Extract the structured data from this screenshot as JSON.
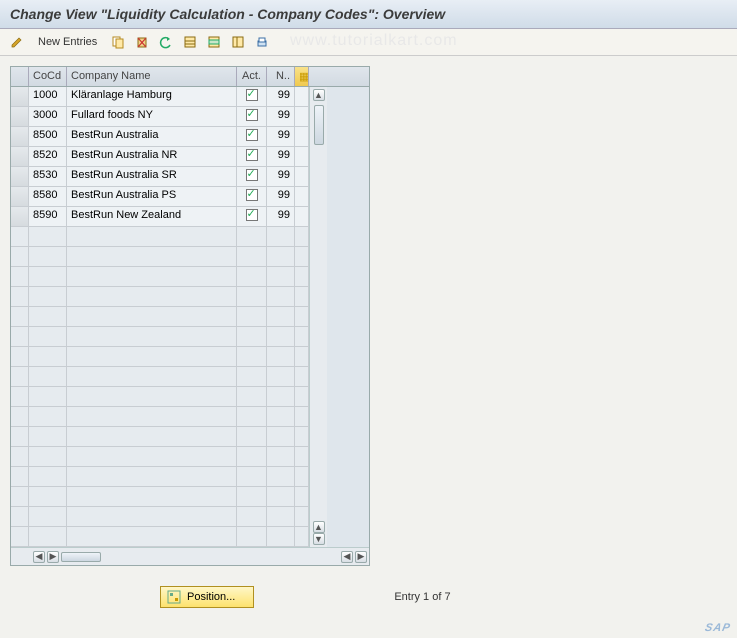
{
  "title": "Change View \"Liquidity Calculation - Company Codes\": Overview",
  "toolbar": {
    "new_entries": "New Entries"
  },
  "watermark": "www.tutorialkart.com",
  "table": {
    "headers": {
      "cocd": "CoCd",
      "name": "Company Name",
      "act": "Act.",
      "n": "N.."
    },
    "rows": [
      {
        "cocd": "1000",
        "name": "Kläranlage Hamburg",
        "act": true,
        "n": "99"
      },
      {
        "cocd": "3000",
        "name": "Fullard foods NY",
        "act": true,
        "n": "99"
      },
      {
        "cocd": "8500",
        "name": "BestRun Australia",
        "act": true,
        "n": "99"
      },
      {
        "cocd": "8520",
        "name": "BestRun Australia NR",
        "act": true,
        "n": "99"
      },
      {
        "cocd": "8530",
        "name": "BestRun Australia SR",
        "act": true,
        "n": "99"
      },
      {
        "cocd": "8580",
        "name": "BestRun Australia PS",
        "act": true,
        "n": "99"
      },
      {
        "cocd": "8590",
        "name": "BestRun New Zealand",
        "act": true,
        "n": "99"
      }
    ],
    "empty_rows": 16
  },
  "footer": {
    "position_label": "Position...",
    "entry_text": "Entry 1 of 7"
  },
  "logo": "SAP"
}
